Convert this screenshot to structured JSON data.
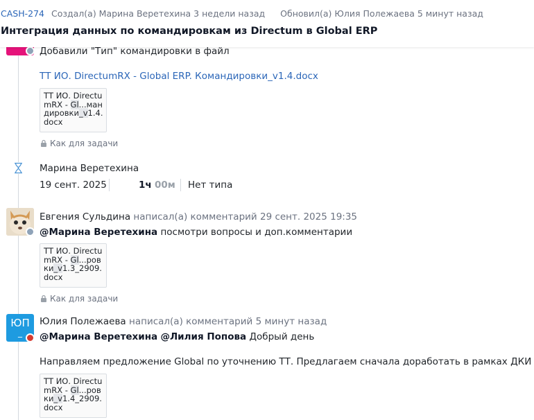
{
  "header": {
    "issue_key": "CASH-274",
    "created_text": "Создал(а) Марина Веретехина 3 недели назад",
    "updated_text": "Обновил(а) Юлия Полежаева 5 минут назад",
    "title": "Интеграция данных по командировкам из Directum в Global ERP"
  },
  "entry1": {
    "text": "Добавили \"Тип\" командировки в файл",
    "file_link": "ТТ ИО. DirectumRX - Global ERP. Командировки_v1.4.docx",
    "file_card": [
      "ТТ ИО. Directu",
      "mRX - Gl...ман",
      "дировки_v1.4.",
      "docx"
    ],
    "visibility": "Как для задачи"
  },
  "worklog": {
    "author": "Марина Веретехина",
    "date": "19 сент. 2025",
    "hours": "1ч",
    "minutes": "00м",
    "type": "Нет типа"
  },
  "comment1": {
    "author": "Евгения Сульдина",
    "action": "написал(а) комментарий 29 сент. 2025 19:35",
    "mention": "@Марина Веретехина",
    "text": "посмотри вопросы и доп.комментарии",
    "file_card": [
      "ТТ ИО. Directu",
      "mRX - Gl...ров",
      "ки_v1.3_2909.",
      "docx"
    ],
    "visibility": "Как для задачи"
  },
  "comment2": {
    "avatar_initials": "ЮП",
    "author": "Юлия Полежаева",
    "action": "написал(а) комментарий 5 минут назад",
    "mention1": "@Марина Веретехина",
    "mention2": "@Лилия Попова",
    "greeting": "Добрый день",
    "body": "Направляем предложение Global по уточнению ТТ. Предлагаем сначала доработать в рамках ДКИ БУ",
    "file_card": [
      "ТТ ИО. Directu",
      "mRX - Gl...ров",
      "ки_v1.4_2909.",
      "docx"
    ]
  },
  "colors": {
    "link": "#2b66b8",
    "avatar_pink": "#e5137a",
    "avatar_blue": "#1e9be0"
  }
}
